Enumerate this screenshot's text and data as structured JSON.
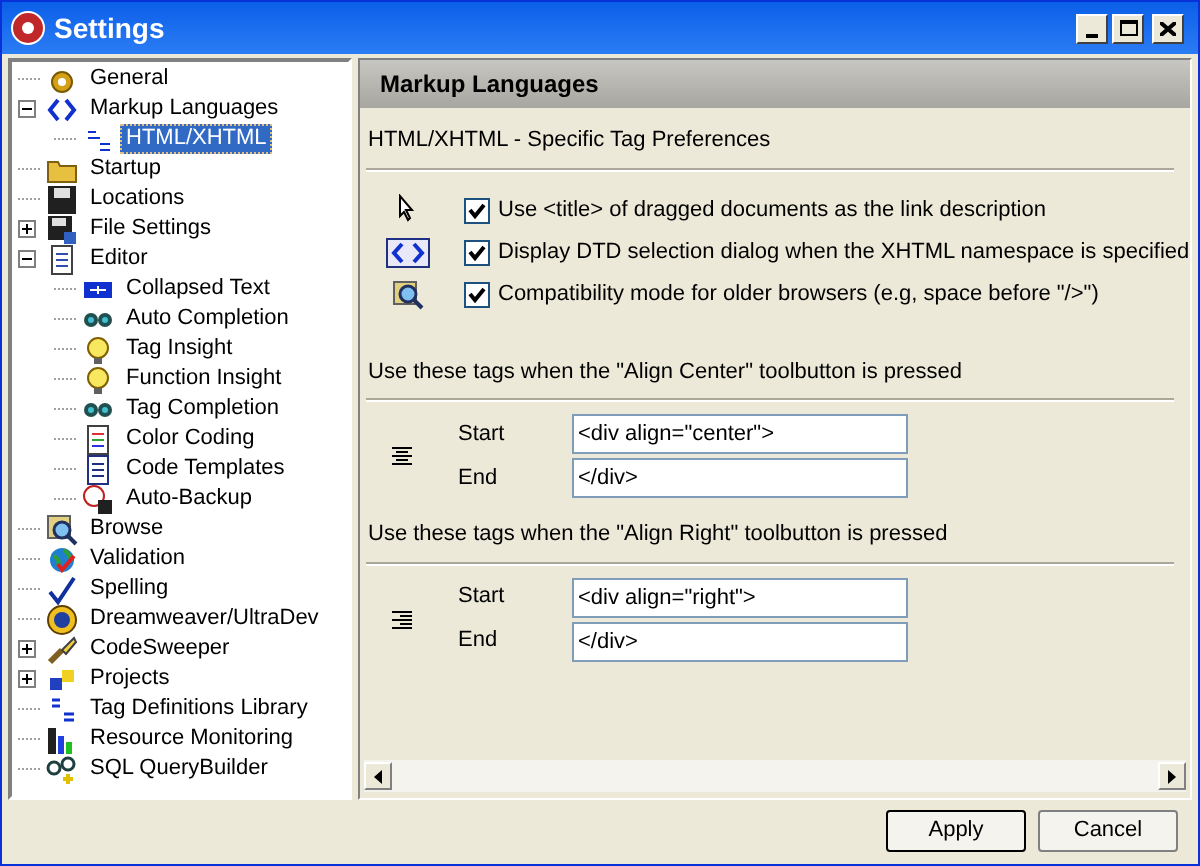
{
  "window": {
    "title": "Settings"
  },
  "tree": [
    {
      "label": "General",
      "selected": false
    },
    {
      "label": "Markup Languages",
      "selected": false,
      "expanded": true,
      "children": [
        {
          "label": "HTML/XHTML",
          "selected": true
        }
      ]
    },
    {
      "label": "Startup",
      "selected": false
    },
    {
      "label": "Locations",
      "selected": false
    },
    {
      "label": "File Settings",
      "selected": false,
      "expanded": false
    },
    {
      "label": "Editor",
      "selected": false,
      "expanded": true,
      "children": [
        {
          "label": "Collapsed Text",
          "selected": false
        },
        {
          "label": "Auto Completion",
          "selected": false
        },
        {
          "label": "Tag Insight",
          "selected": false
        },
        {
          "label": "Function Insight",
          "selected": false
        },
        {
          "label": "Tag Completion",
          "selected": false
        },
        {
          "label": "Color Coding",
          "selected": false
        },
        {
          "label": "Code Templates",
          "selected": false
        },
        {
          "label": "Auto-Backup",
          "selected": false
        }
      ]
    },
    {
      "label": "Browse",
      "selected": false
    },
    {
      "label": "Validation",
      "selected": false
    },
    {
      "label": "Spelling",
      "selected": false
    },
    {
      "label": "Dreamweaver/UltraDev",
      "selected": false
    },
    {
      "label": "CodeSweeper",
      "selected": false,
      "expanded": false
    },
    {
      "label": "Projects",
      "selected": false,
      "expanded": false
    },
    {
      "label": "Tag Definitions Library",
      "selected": false
    },
    {
      "label": "Resource Monitoring",
      "selected": false
    },
    {
      "label": "SQL QueryBuilder",
      "selected": false
    }
  ],
  "panel": {
    "title": "Markup Languages",
    "subtitle": "HTML/XHTML - Specific Tag Preferences",
    "options": [
      {
        "label": "Use <title> of dragged documents as the link description",
        "checked": true
      },
      {
        "label": "Display DTD selection dialog  when the XHTML namespace is specified",
        "checked": true
      },
      {
        "label": "Compatibility mode for older browsers (e.g, space before \"/>\")",
        "checked": true
      }
    ],
    "sections": [
      {
        "title": "Use these tags when the \"Align Center\" toolbutton is pressed",
        "kind": "center",
        "fields": [
          {
            "label": "Start",
            "value": "<div align=\"center\">"
          },
          {
            "label": "End",
            "value": "</div>"
          }
        ]
      },
      {
        "title": "Use these tags when the \"Align Right\" toolbutton is pressed",
        "kind": "right",
        "fields": [
          {
            "label": "Start",
            "value": "<div align=\"right\">"
          },
          {
            "label": "End",
            "value": "</div>"
          }
        ]
      }
    ]
  },
  "buttons": [
    "Apply",
    "Cancel"
  ]
}
